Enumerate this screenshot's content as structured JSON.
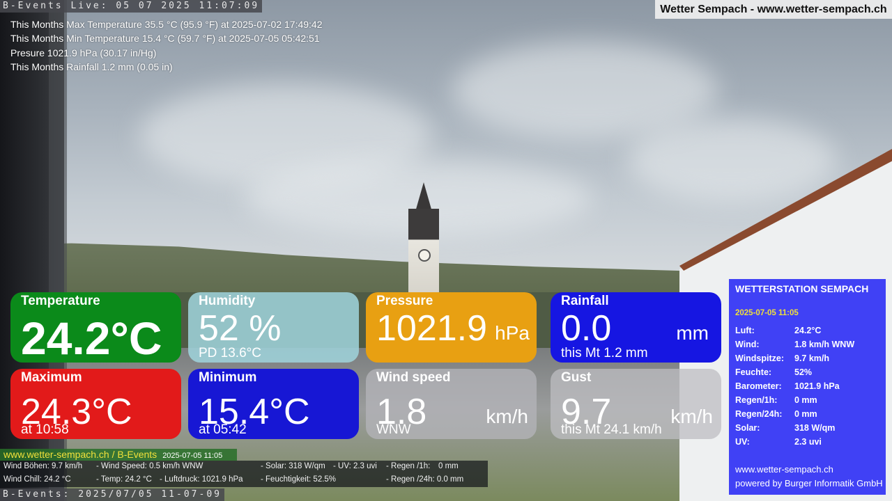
{
  "camera": {
    "top_stamp": "B-Events Live: 05 07 2025 11:07:09",
    "bottom_stamp": "B-Events: 2025/07/05 11-07-09"
  },
  "brand": "Wetter Sempach - www.wetter-sempach.ch",
  "month_stats": [
    "This Months Max Temperature 35.5 °C (95.9 °F) at 2025-07-02 17:49:42",
    "This Months Min Temperature 15.4 °C (59.7 °F) at 2025-07-05 05:42:51",
    "Presure 1021.9 hPa (30.17 in/Hg)",
    "This Months Rainfall 1.2 mm (0.05 in)"
  ],
  "tiles": {
    "temperature": {
      "title": "Temperature",
      "value": "24.2°C",
      "color": "#0b8a1a"
    },
    "humidity": {
      "title": "Humidity",
      "value": "52 %",
      "sub": "PD 13.6°C",
      "color": "#9ed2da"
    },
    "pressure": {
      "title": "Pressure",
      "value": "1021.9",
      "unit": "hPa",
      "color": "#e8a012"
    },
    "rainfall": {
      "title": "Rainfall",
      "value": "0.0",
      "unit": "mm",
      "sub": "this Mt 1.2 mm",
      "color": "#1616e2"
    },
    "maximum": {
      "title": "Maximum",
      "value": "24.3°C",
      "sub": "at 10:58",
      "color": "#e21a1a"
    },
    "minimum": {
      "title": "Minimum",
      "value": "15.4°C",
      "sub": "at 05:42",
      "color": "#1717d4"
    },
    "wind_speed": {
      "title": "Wind speed",
      "value": "1.8",
      "unit": "km/h",
      "sub": "WNW",
      "color": "#b4b4b8"
    },
    "gust": {
      "title": "Gust",
      "value": "9.7",
      "unit": "km/h",
      "sub": "this Mt 24.1 km/h",
      "color": "#bebec2"
    }
  },
  "info_strip": {
    "site": "www.wetter-sempach.ch / B-Events",
    "timestamp": "2025-07-05 11:05",
    "cells": [
      "Wind Böhen: 9.7 km/h",
      "- Wind Speed: 0.5 km/h WNW",
      "- Solar: 318 W/qm",
      "- UV: 2.3 uvi",
      "- Regen /1h:",
      "0 mm",
      "Wind Chill: 24.2 °C",
      "- Temp: 24.2 °C",
      "- Luftdruck: 1021.9 hPa",
      "- Feuchtigkeit: 52.5%",
      "- Regen /24h: 0.0 mm"
    ]
  },
  "station": {
    "title": "WETTERSTATION SEMPACH",
    "date": "2025-07-05 11:05",
    "rows": [
      {
        "label": "Luft:",
        "value": "24.2°C"
      },
      {
        "label": "Wind:",
        "value": "1.8 km/h  WNW"
      },
      {
        "label": "Windspitze:",
        "value": "9.7 km/h"
      },
      {
        "label": "Feuchte:",
        "value": "52%"
      },
      {
        "label": "Barometer:",
        "value": "1021.9 hPa"
      },
      {
        "label": "Regen/1h:",
        "value": "0 mm"
      },
      {
        "label": "Regen/24h:",
        "value": "0 mm"
      },
      {
        "label": "Solar:",
        "value": "318 W/qm"
      },
      {
        "label": "UV:",
        "value": "2.3 uvi"
      }
    ],
    "footer_url": "www.wetter-sempach.ch",
    "footer_credit": "powered by Burger Informatik GmbH",
    "color": "#2828f5"
  }
}
